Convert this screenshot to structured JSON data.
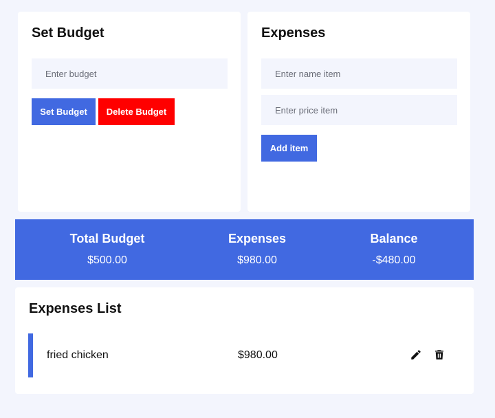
{
  "budget_panel": {
    "title": "Set Budget",
    "input_placeholder": "Enter budget",
    "input_value": "",
    "set_button": "Set Budget",
    "delete_button": "Delete Budget"
  },
  "expense_panel": {
    "title": "Expenses",
    "name_placeholder": "Enter name item",
    "price_placeholder": "Enter price item",
    "add_button": "Add item"
  },
  "summary": {
    "total_budget_label": "Total Budget",
    "total_budget_value": "$500.00",
    "expenses_label": "Expenses",
    "expenses_value": "$980.00",
    "balance_label": "Balance",
    "balance_value": "-$480.00"
  },
  "expenses_list": {
    "title": "Expenses List",
    "items": [
      {
        "name": "fried chicken",
        "price": "$980.00",
        "edit_icon": "pencil-icon",
        "delete_icon": "trash-icon"
      }
    ]
  },
  "colors": {
    "accent": "#4169e1",
    "danger": "#ff0000",
    "background": "#f3f5fd"
  }
}
